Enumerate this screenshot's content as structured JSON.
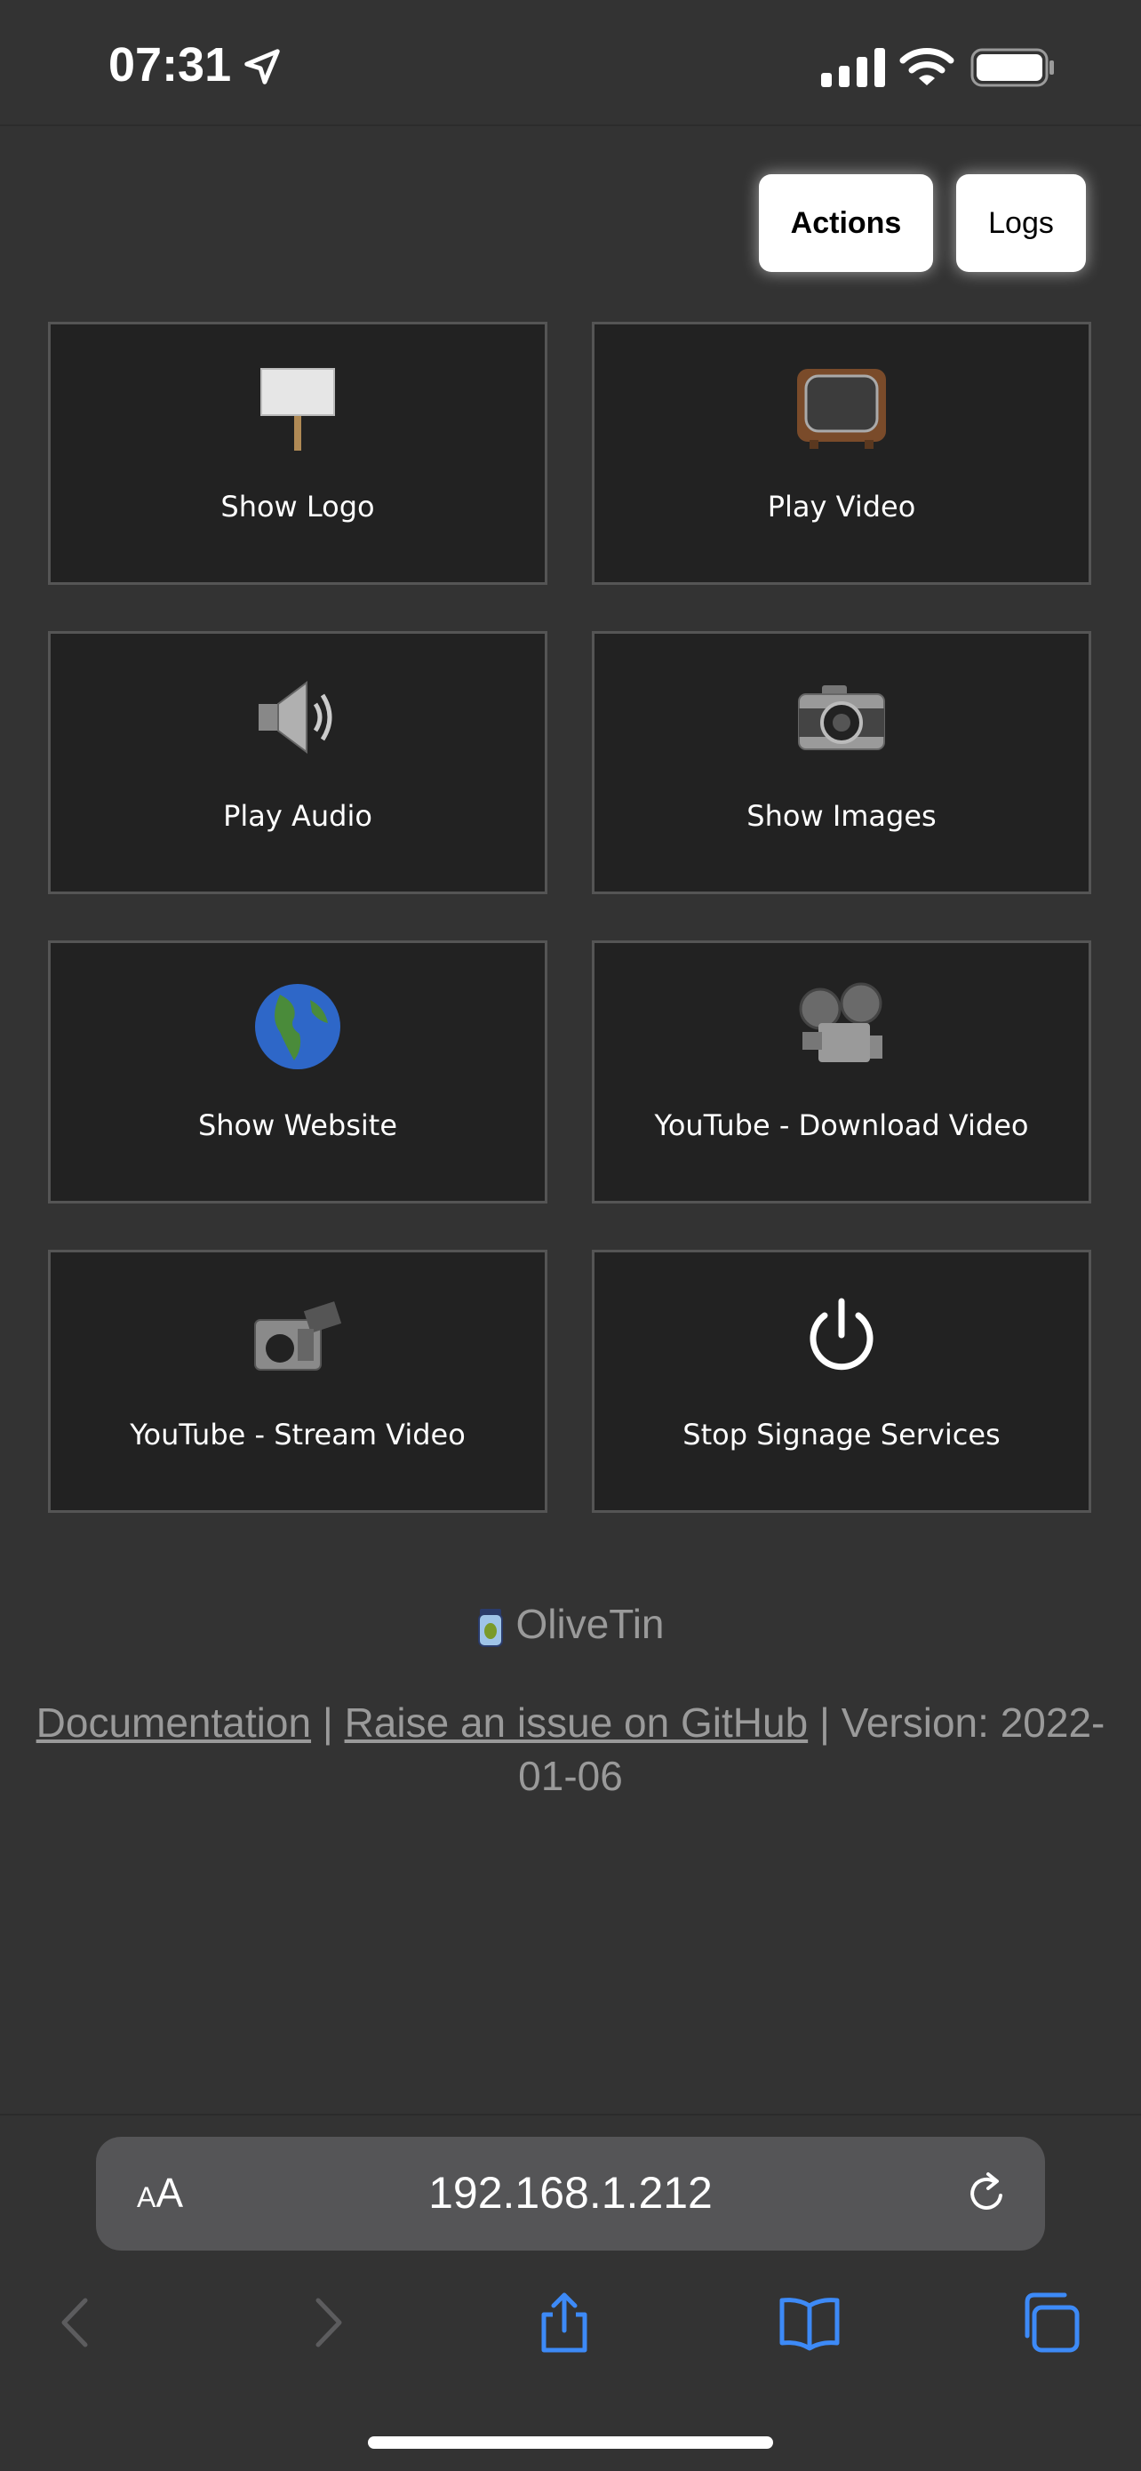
{
  "status": {
    "time": "07:31"
  },
  "tabs": {
    "actions": "Actions",
    "logs": "Logs"
  },
  "actions": [
    {
      "label": "Show Logo",
      "icon": "placard-icon"
    },
    {
      "label": "Play Video",
      "icon": "television-icon"
    },
    {
      "label": "Play Audio",
      "icon": "speaker-icon"
    },
    {
      "label": "Show Images",
      "icon": "camera-icon"
    },
    {
      "label": "Show Website",
      "icon": "globe-icon"
    },
    {
      "label": "YouTube - Download Video",
      "icon": "film-projector-icon"
    },
    {
      "label": "YouTube - Stream Video",
      "icon": "video-camera-icon"
    },
    {
      "label": "Stop Signage Services",
      "icon": "power-icon"
    }
  ],
  "footer": {
    "brand": "OliveTin",
    "documentation": "Documentation",
    "separator": " | ",
    "raise_issue": "Raise an issue on GitHub",
    "version_line1": "Version: 2022-",
    "version_line2": "01-06"
  },
  "browser": {
    "text_size": "AA",
    "url": "192.168.1.212"
  },
  "colors": {
    "background": "#333333",
    "card": "#222222",
    "card_border": "#555555",
    "link_blue": "#3d8af7",
    "muted": "#9a9a9a"
  }
}
